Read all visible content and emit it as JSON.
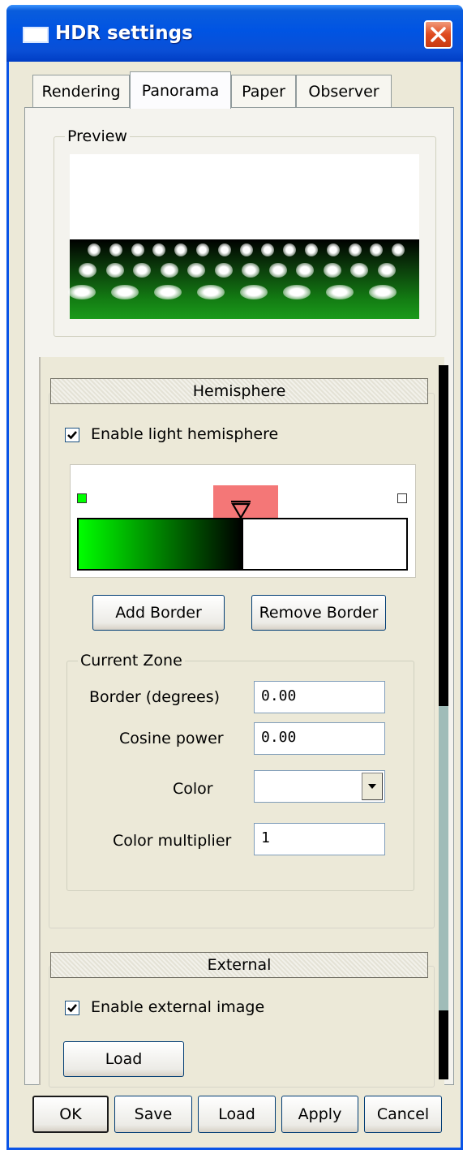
{
  "window": {
    "title": "HDR settings"
  },
  "tabs": [
    {
      "label": "Rendering"
    },
    {
      "label": "Panorama"
    },
    {
      "label": "Paper"
    },
    {
      "label": "Observer"
    }
  ],
  "preview": {
    "label": "Preview"
  },
  "hemisphere": {
    "header": "Hemisphere",
    "enable_label": "Enable light hemisphere",
    "enabled": true,
    "add_border_label": "Add Border",
    "remove_border_label": "Remove Border",
    "gradient": {
      "start_color": "#00ff00",
      "mid_color": "#000000",
      "end_color": "#ffffff",
      "marker_color": "#f47777"
    },
    "current_zone": {
      "label": "Current Zone",
      "border_label": "Border (degrees)",
      "border_value": "0.00",
      "cosine_label": "Cosine power",
      "cosine_value": "0.00",
      "color_label": "Color",
      "color_value": "",
      "multiplier_label": "Color multiplier",
      "multiplier_value": "1"
    }
  },
  "external": {
    "header": "External",
    "enable_label": "Enable external image",
    "enabled": true,
    "load_label": "Load"
  },
  "footer": {
    "ok_label": "OK",
    "save_label": "Save",
    "load_label": "Load",
    "apply_label": "Apply",
    "cancel_label": "Cancel"
  }
}
